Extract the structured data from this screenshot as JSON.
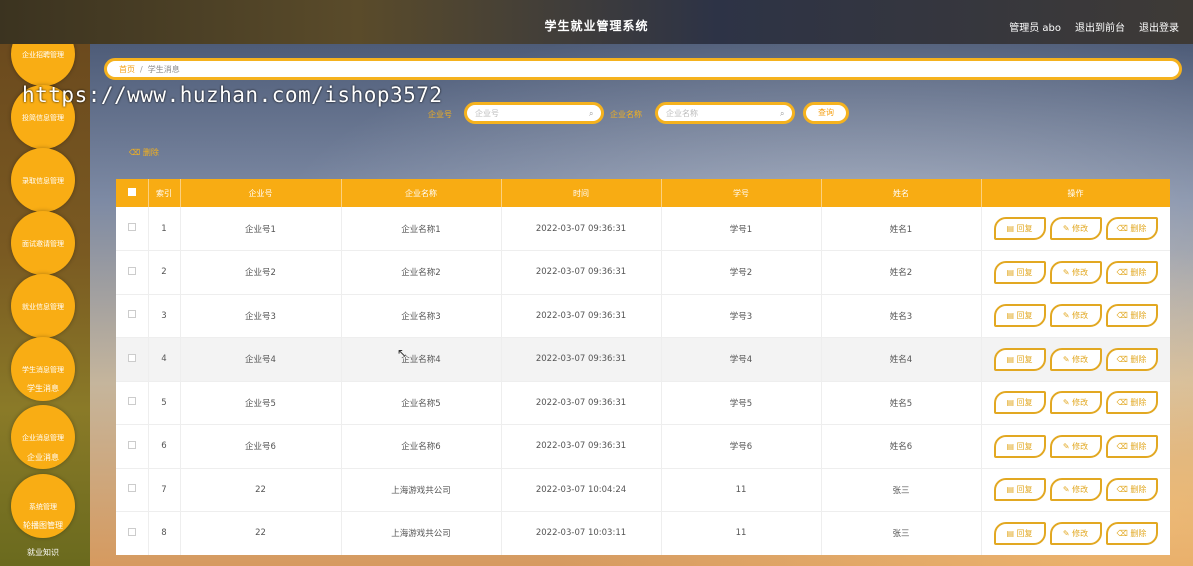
{
  "header": {
    "title": "学生就业管理系统",
    "user": "管理员 abo",
    "to_front": "退出到前台",
    "logout": "退出登录"
  },
  "sidebar": {
    "items": [
      {
        "label": "企业招聘管理"
      },
      {
        "label": "投简信息管理"
      },
      {
        "label": "录取信息管理"
      },
      {
        "label": "面试邀请管理"
      },
      {
        "label": "就业信息管理"
      },
      {
        "label": "学生消息管理",
        "sub": "学生消息"
      },
      {
        "label": "企业消息管理",
        "sub": "企业消息"
      },
      {
        "label": "系统管理",
        "subs": [
          "轮播图管理",
          "就业知识"
        ]
      }
    ]
  },
  "breadcrumb": {
    "home": "首页",
    "current": "学生消息"
  },
  "watermark": "https://www.huzhan.com/ishop3572",
  "search": {
    "company_no_label": "企业号",
    "company_no_placeholder": "企业号",
    "company_name_label": "企业名称",
    "company_name_placeholder": "企业名称",
    "query_label": "查询"
  },
  "delete_label": "删除",
  "table": {
    "headers": [
      "索引",
      "企业号",
      "企业名称",
      "时间",
      "学号",
      "姓名",
      "操作"
    ],
    "rows": [
      {
        "idx": "1",
        "company_no": "企业号1",
        "company_name": "企业名称1",
        "time": "2022-03-07 09:36:31",
        "student_no": "学号1",
        "name": "姓名1"
      },
      {
        "idx": "2",
        "company_no": "企业号2",
        "company_name": "企业名称2",
        "time": "2022-03-07 09:36:31",
        "student_no": "学号2",
        "name": "姓名2"
      },
      {
        "idx": "3",
        "company_no": "企业号3",
        "company_name": "企业名称3",
        "time": "2022-03-07 09:36:31",
        "student_no": "学号3",
        "name": "姓名3"
      },
      {
        "idx": "4",
        "company_no": "企业号4",
        "company_name": "企业名称4",
        "time": "2022-03-07 09:36:31",
        "student_no": "学号4",
        "name": "姓名4"
      },
      {
        "idx": "5",
        "company_no": "企业号5",
        "company_name": "企业名称5",
        "time": "2022-03-07 09:36:31",
        "student_no": "学号5",
        "name": "姓名5"
      },
      {
        "idx": "6",
        "company_no": "企业号6",
        "company_name": "企业名称6",
        "time": "2022-03-07 09:36:31",
        "student_no": "学号6",
        "name": "姓名6"
      },
      {
        "idx": "7",
        "company_no": "22",
        "company_name": "上海游戏共公司",
        "time": "2022-03-07 10:04:24",
        "student_no": "11",
        "name": "张三"
      },
      {
        "idx": "8",
        "company_no": "22",
        "company_name": "上海游戏共公司",
        "time": "2022-03-07 10:03:11",
        "student_no": "11",
        "name": "张三"
      }
    ],
    "actions": {
      "reply": "回复",
      "edit": "修改",
      "delete": "删除"
    }
  },
  "colors": {
    "accent": "#f8ac13",
    "accent_border": "#e2a822"
  }
}
